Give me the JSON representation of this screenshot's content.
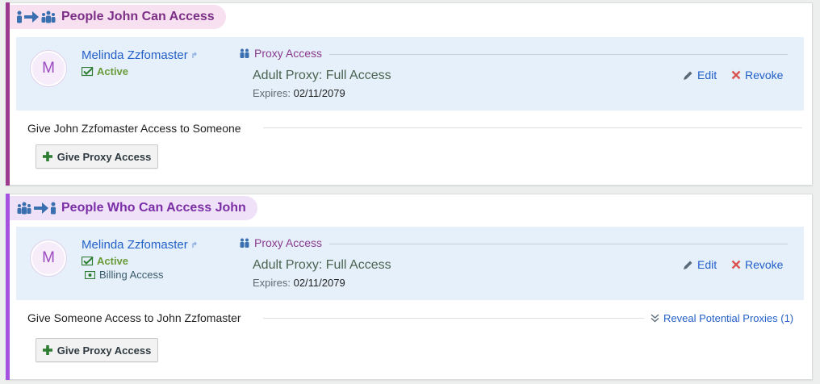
{
  "sections": [
    {
      "title": "People John Can Access",
      "proxies": [
        {
          "avatar_initial": "M",
          "name": "Melinda Zzfomaster",
          "status": "Active",
          "access_label": "Proxy Access",
          "access_type": "Adult Proxy: Full Access",
          "expires_label": "Expires:",
          "expires_date": "02/11/2079",
          "edit_label": "Edit",
          "revoke_label": "Revoke"
        }
      ],
      "give_text": "Give John Zzfomaster Access to Someone",
      "button_label": "Give Proxy Access"
    },
    {
      "title": "People Who Can Access John",
      "proxies": [
        {
          "avatar_initial": "M",
          "name": "Melinda Zzfomaster",
          "status": "Active",
          "billing": "Billing Access",
          "access_label": "Proxy Access",
          "access_type": "Adult Proxy: Full Access",
          "expires_label": "Expires:",
          "expires_date": "02/11/2079",
          "edit_label": "Edit",
          "revoke_label": "Revoke"
        }
      ],
      "give_text": "Give Someone Access to John Zzfomaster",
      "reveal_label": "Reveal Potential Proxies (1)",
      "button_label": "Give Proxy Access"
    }
  ],
  "icons": {
    "section1_title": [
      "person-icon",
      "arrow-right-icon",
      "group-icon"
    ],
    "section2_title": [
      "group-icon",
      "arrow-right-icon",
      "person-icon"
    ],
    "name_link": "external-link-icon",
    "status": "checkmark-icon",
    "billing": "billing-icon",
    "proxy_access": "proxy-icon",
    "edit": "pencil-icon",
    "revoke": "close-icon",
    "button": "plus-icon",
    "reveal": "double-chevron-down-icon"
  },
  "colors": {
    "section1_accent": "#9b3a8e",
    "section2_accent": "#a552e0",
    "link": "#2360c8",
    "active": "#6a9b3a",
    "card_bg": "#e6f0fb"
  }
}
